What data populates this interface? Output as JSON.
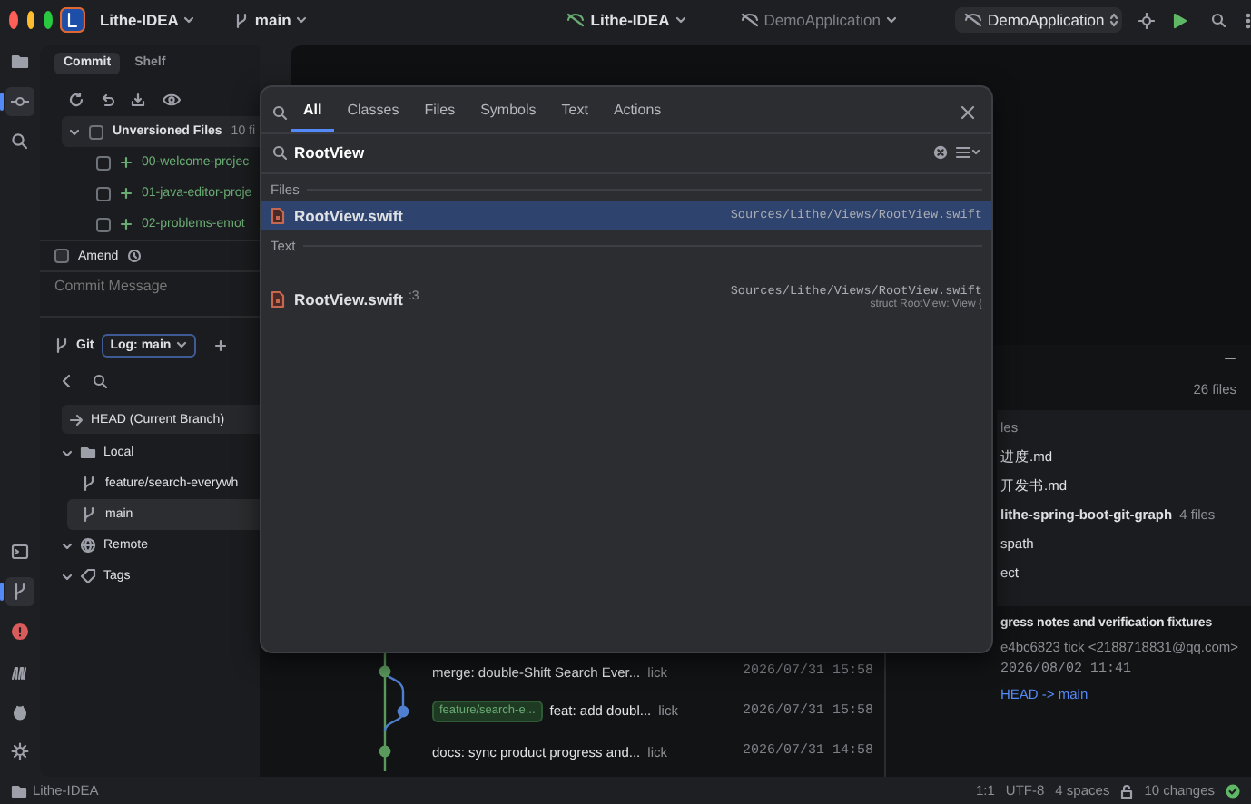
{
  "title_bar": {
    "project": "Lithe-IDEA",
    "branch": "main",
    "center_project": "Lithe-IDEA",
    "center_config": "DemoApplication",
    "run_config": "DemoApplication"
  },
  "tool_strip": {
    "top": [
      {
        "selected": false
      },
      {
        "selected": true
      },
      {
        "selected": false
      }
    ],
    "bottom": [
      {
        "selected": false
      },
      {
        "selected": true
      },
      {
        "selected": false
      },
      {
        "selected": false
      },
      {
        "selected": false
      },
      {
        "selected": false
      }
    ]
  },
  "commit_panel": {
    "tabs": [
      {
        "label": "Commit",
        "selected": true
      },
      {
        "label": "Shelf",
        "selected": false
      }
    ],
    "group": {
      "label": "Unversioned Files",
      "count": "10 fi",
      "expanded": true,
      "checked": false
    },
    "files": [
      {
        "name": "00-welcome-projec",
        "checked": false
      },
      {
        "name": "01-java-editor-proje",
        "checked": false
      },
      {
        "name": "02-problems-emot",
        "checked": false
      }
    ],
    "amend": {
      "label": "Amend",
      "checked": false
    },
    "message": {
      "placeholder": "Commit Message"
    }
  },
  "git_panel": {
    "title": "Git",
    "log_tab": "Log: main",
    "head": "HEAD (Current Branch)",
    "tree": [
      {
        "label": "Local",
        "kind": "folder",
        "expanded": true,
        "children": [
          {
            "label": "feature/search-everywh",
            "selected": false
          },
          {
            "label": "main",
            "selected": true
          }
        ]
      },
      {
        "label": "Remote",
        "kind": "remote",
        "expanded": true
      },
      {
        "label": "Tags",
        "kind": "tag",
        "expanded": true
      }
    ]
  },
  "log": {
    "commits": [
      {
        "message": "merge: double-Shift Search Ever...",
        "author": "lick",
        "date": "2026/07/31 15:58",
        "color": "#5b9a5d"
      },
      {
        "branch_label": "feature/search-e...",
        "message": "feat: add doubl...",
        "author": "lick",
        "date": "2026/07/31 15:58",
        "color": "#4f7fd0"
      },
      {
        "message": "docs: sync product progress and...",
        "author": "lick",
        "date": "2026/07/31 14:58",
        "color": "#5b9a5d"
      }
    ]
  },
  "changes": {
    "count": "26 files",
    "items": [
      {
        "kind": "header",
        "name": "les"
      },
      {
        "kind": "file",
        "name": "进度.md"
      },
      {
        "kind": "file",
        "name": "开发书.md"
      },
      {
        "kind": "folder",
        "name": "lithe-spring-boot-git-graph",
        "count": "4 files"
      },
      {
        "kind": "file",
        "name": "spath"
      },
      {
        "kind": "file",
        "name": "ect"
      }
    ]
  },
  "details": {
    "subject": "gress notes and verification fixtures",
    "meta": "e4bc6823 tick <2188718831@qq.com>",
    "date": "2026/08/02 11:41",
    "refs": "HEAD -> main"
  },
  "popup": {
    "tabs": [
      {
        "label": "All",
        "selected": true
      },
      {
        "label": "Classes",
        "selected": false
      },
      {
        "label": "Files",
        "selected": false
      },
      {
        "label": "Symbols",
        "selected": false
      },
      {
        "label": "Text",
        "selected": false
      },
      {
        "label": "Actions",
        "selected": false
      }
    ],
    "query": "RootView",
    "sections": [
      {
        "title": "Files",
        "results": [
          {
            "name": "RootView.swift",
            "path": "Sources/Lithe/Views/RootView.swift",
            "selected": true
          }
        ]
      },
      {
        "title": "Text",
        "results": [
          {
            "name": "RootView.swift",
            "line": ":3",
            "path": "Sources/Lithe/Views/RootView.swift",
            "snippet": "struct RootView: View {",
            "selected": false
          }
        ]
      }
    ]
  },
  "status_bar": {
    "project": "Lithe-IDEA",
    "position": "1:1",
    "encoding": "UTF-8",
    "indent": "4 spaces",
    "changes": "10 changes"
  }
}
